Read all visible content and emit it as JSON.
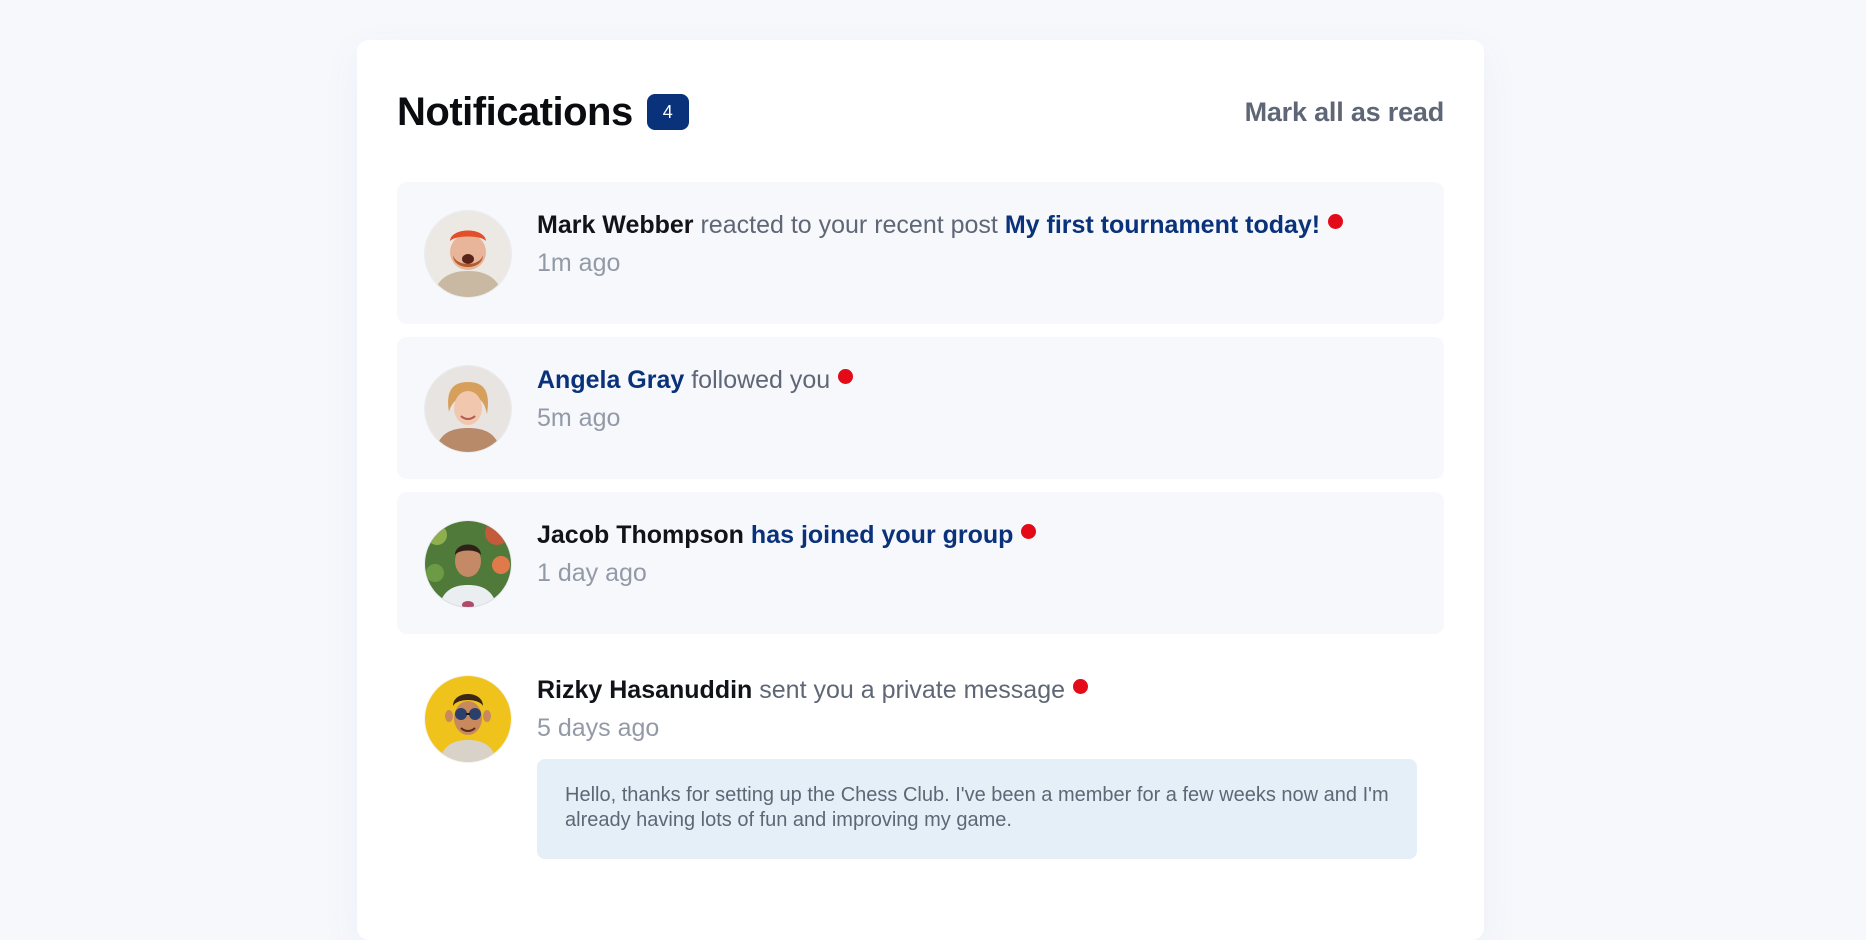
{
  "header": {
    "title": "Notifications",
    "unread_count": "4",
    "mark_all_label": "Mark all as read"
  },
  "colors": {
    "page_bg": "#f6f8fc",
    "card_bg": "#ffffff",
    "unread_item_bg": "#f6f8fc",
    "accent_navy": "#0a327b",
    "unread_dot": "#e30b17",
    "message_bg": "#e5eff8",
    "muted_text": "#5f6776",
    "time_text": "#939aa7"
  },
  "notifications": [
    {
      "name": "Mark Webber",
      "action": "reacted to your recent post",
      "target": "My first tournament today!",
      "time": "1m ago",
      "unread": true,
      "avatar_icon": "avatar-mark-webber"
    },
    {
      "name": "Angela Gray",
      "action": "followed you",
      "time": "5m ago",
      "unread": true,
      "avatar_icon": "avatar-angela-gray"
    },
    {
      "name": "Jacob Thompson",
      "action": "has joined your group",
      "time": "1 day ago",
      "unread": true,
      "avatar_icon": "avatar-jacob-thompson"
    },
    {
      "name": "Rizky Hasanuddin",
      "action": "sent you a private message",
      "time": "5 days ago",
      "unread": true,
      "avatar_icon": "avatar-rizky-hasanuddin",
      "message": "Hello, thanks for setting up the Chess Club. I've been a member for a few weeks now and I'm already having lots of fun and improving my game."
    }
  ]
}
